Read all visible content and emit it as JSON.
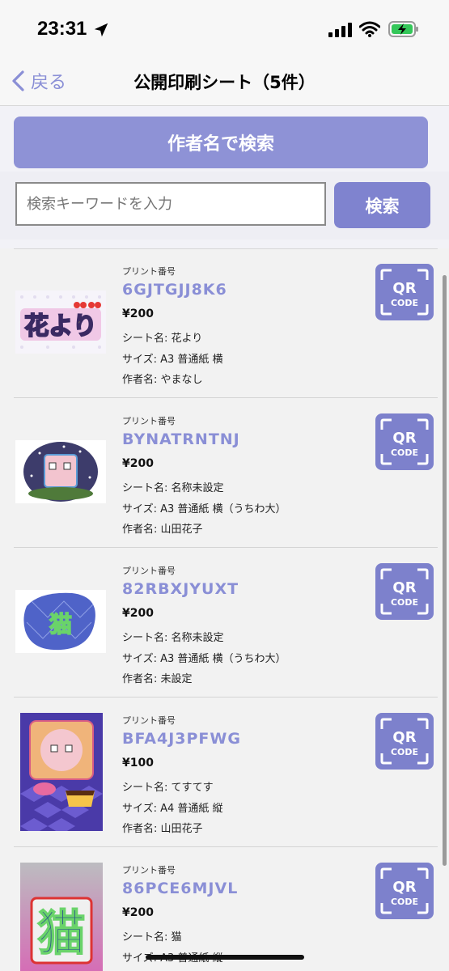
{
  "status": {
    "time": "23:31"
  },
  "nav": {
    "back_label": "戻る",
    "title": "公開印刷シート（5件）"
  },
  "author_search_label": "作者名で検索",
  "search": {
    "placeholder": "検索キーワードを入力",
    "button_label": "検索"
  },
  "qr": {
    "line1": "QR",
    "line2": "CODE"
  },
  "colors": {
    "accent": "#8a8fd6",
    "button": "#8e92d6",
    "qr_bg": "#7d81cc"
  },
  "items": [
    {
      "print_label": "プリント番号",
      "code": "6GJTGJJ8K6",
      "price": "¥200",
      "sheet": "シート名: 花より",
      "size": "サイズ: A3 普通紙 横",
      "author": "作者名: やまなし",
      "thumb_text": "花より"
    },
    {
      "print_label": "プリント番号",
      "code": "BYNATRNTNJ",
      "price": "¥200",
      "sheet": "シート名: 名称未設定",
      "size": "サイズ: A3 普通紙 横（うちわ大）",
      "author": "作者名: 山田花子"
    },
    {
      "print_label": "プリント番号",
      "code": "82RBXJYUXT",
      "price": "¥200",
      "sheet": "シート名: 名称未設定",
      "size": "サイズ: A3 普通紙 横（うちわ大）",
      "author": "作者名: 未設定",
      "thumb_text": "猫"
    },
    {
      "print_label": "プリント番号",
      "code": "BFA4J3PFWG",
      "price": "¥100",
      "sheet": "シート名: てすてす",
      "size": "サイズ: A4 普通紙 縦",
      "author": "作者名: 山田花子"
    },
    {
      "print_label": "プリント番号",
      "code": "86PCE6MJVL",
      "price": "¥200",
      "sheet": "シート名: 猫",
      "size": "サイズ: A3 普通紙 縦",
      "thumb_text": "猫"
    }
  ]
}
